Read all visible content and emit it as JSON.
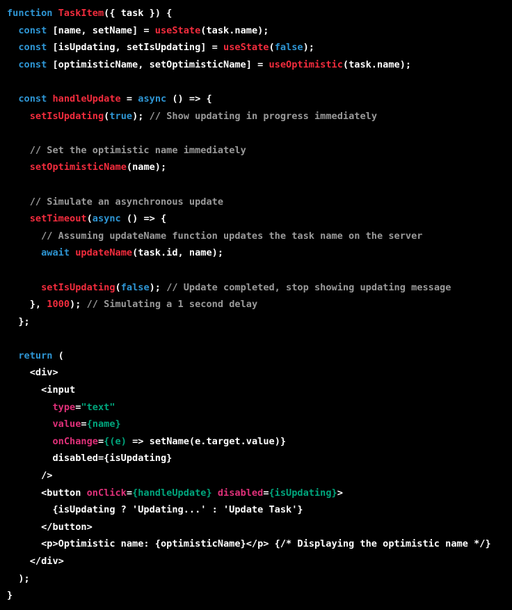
{
  "theme": {
    "background": "#000000",
    "colors": {
      "plain": "#ffffff",
      "keyword": "#2e95d3",
      "function": "#f22c3d",
      "comment": "#9a9a9a",
      "string": "#00a67d",
      "attr": "#df3079"
    }
  },
  "code": {
    "lines": [
      [
        {
          "t": "keyword",
          "v": "function "
        },
        {
          "t": "function",
          "v": "TaskItem"
        },
        {
          "t": "plain",
          "v": "({ task }) {"
        }
      ],
      [
        {
          "t": "plain",
          "v": "  "
        },
        {
          "t": "keyword",
          "v": "const"
        },
        {
          "t": "plain",
          "v": " [name, setName] = "
        },
        {
          "t": "function",
          "v": "useState"
        },
        {
          "t": "plain",
          "v": "(task.name);"
        }
      ],
      [
        {
          "t": "plain",
          "v": "  "
        },
        {
          "t": "keyword",
          "v": "const"
        },
        {
          "t": "plain",
          "v": " [isUpdating, setIsUpdating] = "
        },
        {
          "t": "function",
          "v": "useState"
        },
        {
          "t": "plain",
          "v": "("
        },
        {
          "t": "keyword",
          "v": "false"
        },
        {
          "t": "plain",
          "v": ");"
        }
      ],
      [
        {
          "t": "plain",
          "v": "  "
        },
        {
          "t": "keyword",
          "v": "const"
        },
        {
          "t": "plain",
          "v": " [optimisticName, setOptimisticName] = "
        },
        {
          "t": "function",
          "v": "useOptimistic"
        },
        {
          "t": "plain",
          "v": "(task.name);"
        }
      ],
      [],
      [
        {
          "t": "plain",
          "v": "  "
        },
        {
          "t": "keyword",
          "v": "const"
        },
        {
          "t": "plain",
          "v": " "
        },
        {
          "t": "function",
          "v": "handleUpdate"
        },
        {
          "t": "plain",
          "v": " = "
        },
        {
          "t": "keyword",
          "v": "async"
        },
        {
          "t": "plain",
          "v": " () => {"
        }
      ],
      [
        {
          "t": "plain",
          "v": "    "
        },
        {
          "t": "function",
          "v": "setIsUpdating"
        },
        {
          "t": "plain",
          "v": "("
        },
        {
          "t": "keyword",
          "v": "true"
        },
        {
          "t": "plain",
          "v": "); "
        },
        {
          "t": "comment",
          "v": "// Show updating in progress immediately"
        }
      ],
      [],
      [
        {
          "t": "plain",
          "v": "    "
        },
        {
          "t": "comment",
          "v": "// Set the optimistic name immediately"
        }
      ],
      [
        {
          "t": "plain",
          "v": "    "
        },
        {
          "t": "function",
          "v": "setOptimisticName"
        },
        {
          "t": "plain",
          "v": "(name);"
        }
      ],
      [],
      [
        {
          "t": "plain",
          "v": "    "
        },
        {
          "t": "comment",
          "v": "// Simulate an asynchronous update"
        }
      ],
      [
        {
          "t": "plain",
          "v": "    "
        },
        {
          "t": "function",
          "v": "setTimeout"
        },
        {
          "t": "plain",
          "v": "("
        },
        {
          "t": "keyword",
          "v": "async"
        },
        {
          "t": "plain",
          "v": " () => {"
        }
      ],
      [
        {
          "t": "plain",
          "v": "      "
        },
        {
          "t": "comment",
          "v": "// Assuming updateName function updates the task name on the server"
        }
      ],
      [
        {
          "t": "plain",
          "v": "      "
        },
        {
          "t": "keyword",
          "v": "await"
        },
        {
          "t": "plain",
          "v": " "
        },
        {
          "t": "function",
          "v": "updateName"
        },
        {
          "t": "plain",
          "v": "(task.id, name);"
        }
      ],
      [],
      [
        {
          "t": "plain",
          "v": "      "
        },
        {
          "t": "function",
          "v": "setIsUpdating"
        },
        {
          "t": "plain",
          "v": "("
        },
        {
          "t": "keyword",
          "v": "false"
        },
        {
          "t": "plain",
          "v": "); "
        },
        {
          "t": "comment",
          "v": "// Update completed, stop showing updating message"
        }
      ],
      [
        {
          "t": "plain",
          "v": "    }, "
        },
        {
          "t": "function",
          "v": "1000"
        },
        {
          "t": "plain",
          "v": "); "
        },
        {
          "t": "comment",
          "v": "// Simulating a 1 second delay"
        }
      ],
      [
        {
          "t": "plain",
          "v": "  };"
        }
      ],
      [],
      [
        {
          "t": "plain",
          "v": "  "
        },
        {
          "t": "keyword",
          "v": "return"
        },
        {
          "t": "plain",
          "v": " ("
        }
      ],
      [
        {
          "t": "plain",
          "v": "    <div>"
        }
      ],
      [
        {
          "t": "plain",
          "v": "      <input"
        }
      ],
      [
        {
          "t": "plain",
          "v": "        "
        },
        {
          "t": "attr",
          "v": "type"
        },
        {
          "t": "plain",
          "v": "="
        },
        {
          "t": "string",
          "v": "\"text\""
        }
      ],
      [
        {
          "t": "plain",
          "v": "        "
        },
        {
          "t": "attr",
          "v": "value"
        },
        {
          "t": "plain",
          "v": "="
        },
        {
          "t": "string",
          "v": "{name}"
        }
      ],
      [
        {
          "t": "plain",
          "v": "        "
        },
        {
          "t": "attr",
          "v": "onChange"
        },
        {
          "t": "plain",
          "v": "="
        },
        {
          "t": "string",
          "v": "{(e)"
        },
        {
          "t": "plain",
          "v": " => setName(e.target.value)}"
        }
      ],
      [
        {
          "t": "plain",
          "v": "        disabled={isUpdating}"
        }
      ],
      [
        {
          "t": "plain",
          "v": "      />"
        }
      ],
      [
        {
          "t": "plain",
          "v": "      <button "
        },
        {
          "t": "attr",
          "v": "onClick"
        },
        {
          "t": "plain",
          "v": "="
        },
        {
          "t": "string",
          "v": "{handleUpdate}"
        },
        {
          "t": "plain",
          "v": " "
        },
        {
          "t": "attr",
          "v": "disabled"
        },
        {
          "t": "plain",
          "v": "="
        },
        {
          "t": "string",
          "v": "{isUpdating}"
        },
        {
          "t": "plain",
          "v": ">"
        }
      ],
      [
        {
          "t": "plain",
          "v": "        {isUpdating ? 'Updating...' : 'Update Task'}"
        }
      ],
      [
        {
          "t": "plain",
          "v": "      </button>"
        }
      ],
      [
        {
          "t": "plain",
          "v": "      <p>Optimistic name: {optimisticName}</p> {/* Displaying the optimistic name */}"
        }
      ],
      [
        {
          "t": "plain",
          "v": "    </div>"
        }
      ],
      [
        {
          "t": "plain",
          "v": "  );"
        }
      ],
      [
        {
          "t": "plain",
          "v": "}"
        }
      ]
    ]
  }
}
